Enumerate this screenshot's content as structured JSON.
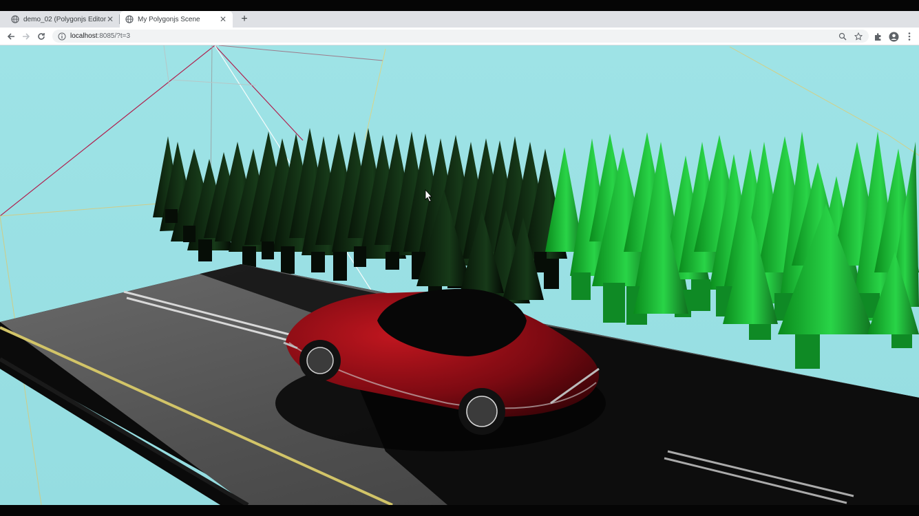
{
  "browser": {
    "tabs": [
      {
        "title": "demo_02 (Polygonjs Editor)",
        "active": false
      },
      {
        "title": "My Polygonjs Scene",
        "active": true
      }
    ],
    "new_tab_icon": "plus-icon",
    "url_host": "localhost",
    "url_rest": ":8085/?t=3",
    "toolbar_icons": [
      "back-arrow-icon",
      "forward-arrow-icon",
      "reload-icon",
      "info-icon",
      "zoom-icon",
      "star-icon",
      "puzzle-extension-icon",
      "profile-icon",
      "kebab-menu-icon"
    ]
  },
  "scene": {
    "sky_color": "#9de3e6",
    "road_color": "#3a3a3a",
    "car_color": "#8e0b13",
    "tree_color_lit": "#27c23f",
    "tree_color_shadow": "#0a1a0b",
    "objects": [
      "road",
      "car",
      "pine-trees",
      "camera-helper-lines"
    ]
  }
}
